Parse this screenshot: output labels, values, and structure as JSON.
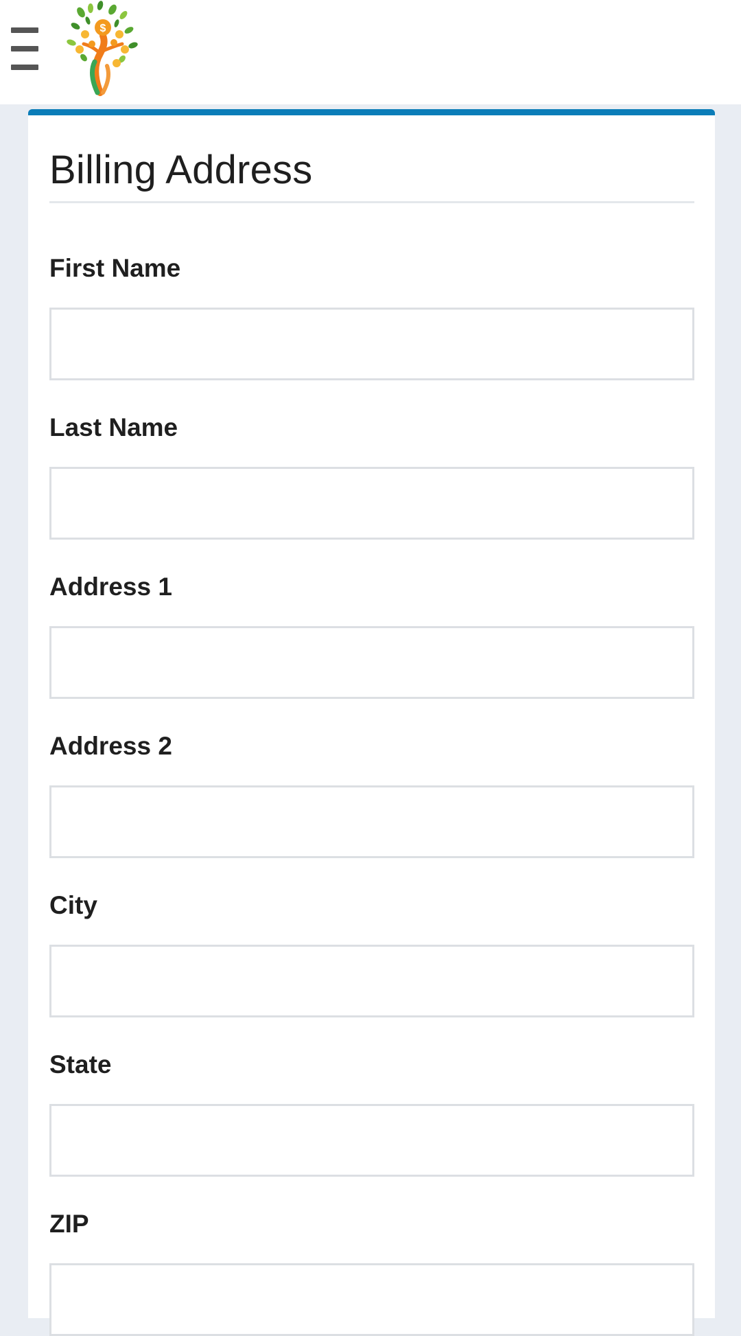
{
  "header": {
    "menu_icon": "hamburger-menu-icon",
    "logo_icon": "money-tree-logo"
  },
  "form": {
    "title": "Billing Address",
    "accent_color": "#0b7db8",
    "fields": [
      {
        "label": "First Name",
        "value": ""
      },
      {
        "label": "Last Name",
        "value": ""
      },
      {
        "label": "Address 1",
        "value": ""
      },
      {
        "label": "Address 2",
        "value": ""
      },
      {
        "label": "City",
        "value": ""
      },
      {
        "label": "State",
        "value": ""
      },
      {
        "label": "ZIP",
        "value": ""
      }
    ]
  }
}
